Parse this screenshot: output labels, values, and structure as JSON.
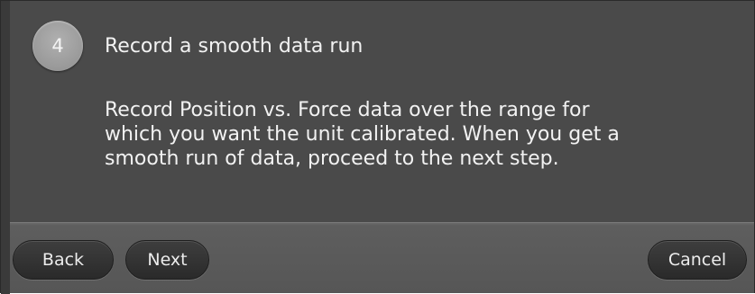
{
  "step": {
    "number": "4",
    "title": "Record a smooth data run",
    "body_lines": [
      "Record Position vs. Force data over the range for",
      "which you want the unit calibrated. When you get a",
      "smooth run of data, proceed to the next step."
    ]
  },
  "footer": {
    "back_label": "Back",
    "next_label": "Next",
    "cancel_label": "Cancel"
  },
  "colors": {
    "background": "#4a4a4a",
    "footer": "#5e5e5e",
    "button": "#333333",
    "badge": "#999999",
    "text": "#f2f2f2"
  }
}
